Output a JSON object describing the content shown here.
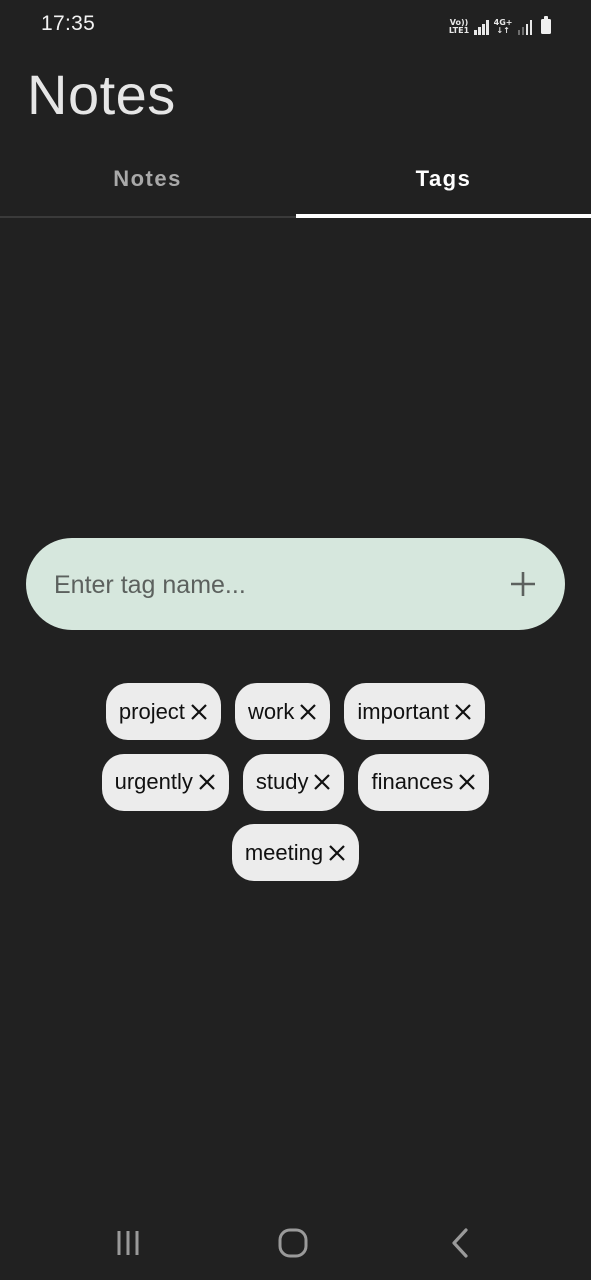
{
  "status_bar": {
    "time": "17:35",
    "network_1": "Vo)) LTE1",
    "network_2": "4G+",
    "icons": [
      "signal-icon",
      "signal-icon",
      "battery-icon"
    ]
  },
  "app": {
    "title": "Notes"
  },
  "tabs": [
    {
      "label": "Notes",
      "selected": false
    },
    {
      "label": "Tags",
      "selected": true
    }
  ],
  "tag_input": {
    "value": "",
    "placeholder": "Enter tag name...",
    "add_icon": "plus-icon"
  },
  "tags": [
    [
      "project",
      "work",
      "important"
    ],
    [
      "urgently",
      "study",
      "finances"
    ],
    [
      "meeting"
    ]
  ],
  "nav_bar": {
    "icons": [
      "recent-apps-icon",
      "home-icon",
      "back-icon"
    ]
  },
  "colors": {
    "background": "#212121",
    "input_background": "#d6e7dd",
    "chip_background": "#ececec",
    "tab_indicator": "#ffffff"
  }
}
